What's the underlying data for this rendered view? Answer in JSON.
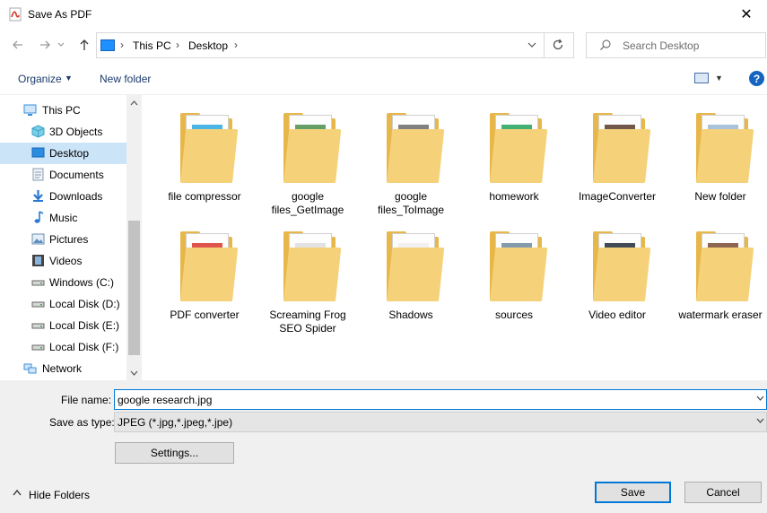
{
  "window": {
    "title": "Save As PDF",
    "close_label": "✕"
  },
  "nav": {
    "back_icon": "arrow-left-icon",
    "forward_icon": "arrow-right-icon",
    "up_icon": "arrow-up-icon",
    "breadcrumb": [
      "This PC",
      "Desktop"
    ],
    "search_placeholder": "Search Desktop"
  },
  "toolbar": {
    "organize_label": "Organize",
    "new_folder_label": "New folder",
    "help_label": "?"
  },
  "sidebar": {
    "items": [
      {
        "label": "This PC",
        "icon": "computer-icon",
        "level": "top"
      },
      {
        "label": "3D Objects",
        "icon": "cube-icon",
        "level": "child"
      },
      {
        "label": "Desktop",
        "icon": "desktop-icon",
        "level": "child",
        "selected": true
      },
      {
        "label": "Documents",
        "icon": "document-icon",
        "level": "child"
      },
      {
        "label": "Downloads",
        "icon": "download-icon",
        "level": "child"
      },
      {
        "label": "Music",
        "icon": "music-note-icon",
        "level": "child"
      },
      {
        "label": "Pictures",
        "icon": "picture-icon",
        "level": "child"
      },
      {
        "label": "Videos",
        "icon": "film-icon",
        "level": "child"
      },
      {
        "label": "Windows (C:)",
        "icon": "drive-icon",
        "level": "child"
      },
      {
        "label": "Local Disk (D:)",
        "icon": "drive-icon",
        "level": "child"
      },
      {
        "label": "Local Disk (E:)",
        "icon": "drive-icon",
        "level": "child"
      },
      {
        "label": "Local Disk (F:)",
        "icon": "drive-icon",
        "level": "child"
      },
      {
        "label": "Network",
        "icon": "network-icon",
        "level": "top"
      }
    ]
  },
  "files": [
    {
      "label": "file compressor",
      "accent": "#2da8e0"
    },
    {
      "label": "google files_GetImage",
      "accent": "#4a8e4a"
    },
    {
      "label": "google files_ToImage",
      "accent": "#6a6a6a"
    },
    {
      "label": "homework",
      "accent": "#22a35a"
    },
    {
      "label": "ImageConverter",
      "accent": "#5a3a2a"
    },
    {
      "label": "New folder",
      "accent": "#9bb7d6"
    },
    {
      "label": "PDF converter",
      "accent": "#d9362b"
    },
    {
      "label": "Screaming Frog SEO Spider",
      "accent": "#dddddd"
    },
    {
      "label": "Shadows",
      "accent": "#eeeeee"
    },
    {
      "label": "sources",
      "accent": "#6e8aa0"
    },
    {
      "label": "Video editor",
      "accent": "#222b3a"
    },
    {
      "label": "watermark eraser",
      "accent": "#7a4a32"
    }
  ],
  "form": {
    "file_name_label": "File name:",
    "file_name_value": "google research.jpg",
    "save_type_label": "Save as type:",
    "save_type_value": "JPEG (*.jpg,*.jpeg,*.jpe)",
    "settings_label": "Settings..."
  },
  "footer": {
    "hide_folders_label": "Hide Folders",
    "save_label": "Save",
    "cancel_label": "Cancel"
  }
}
